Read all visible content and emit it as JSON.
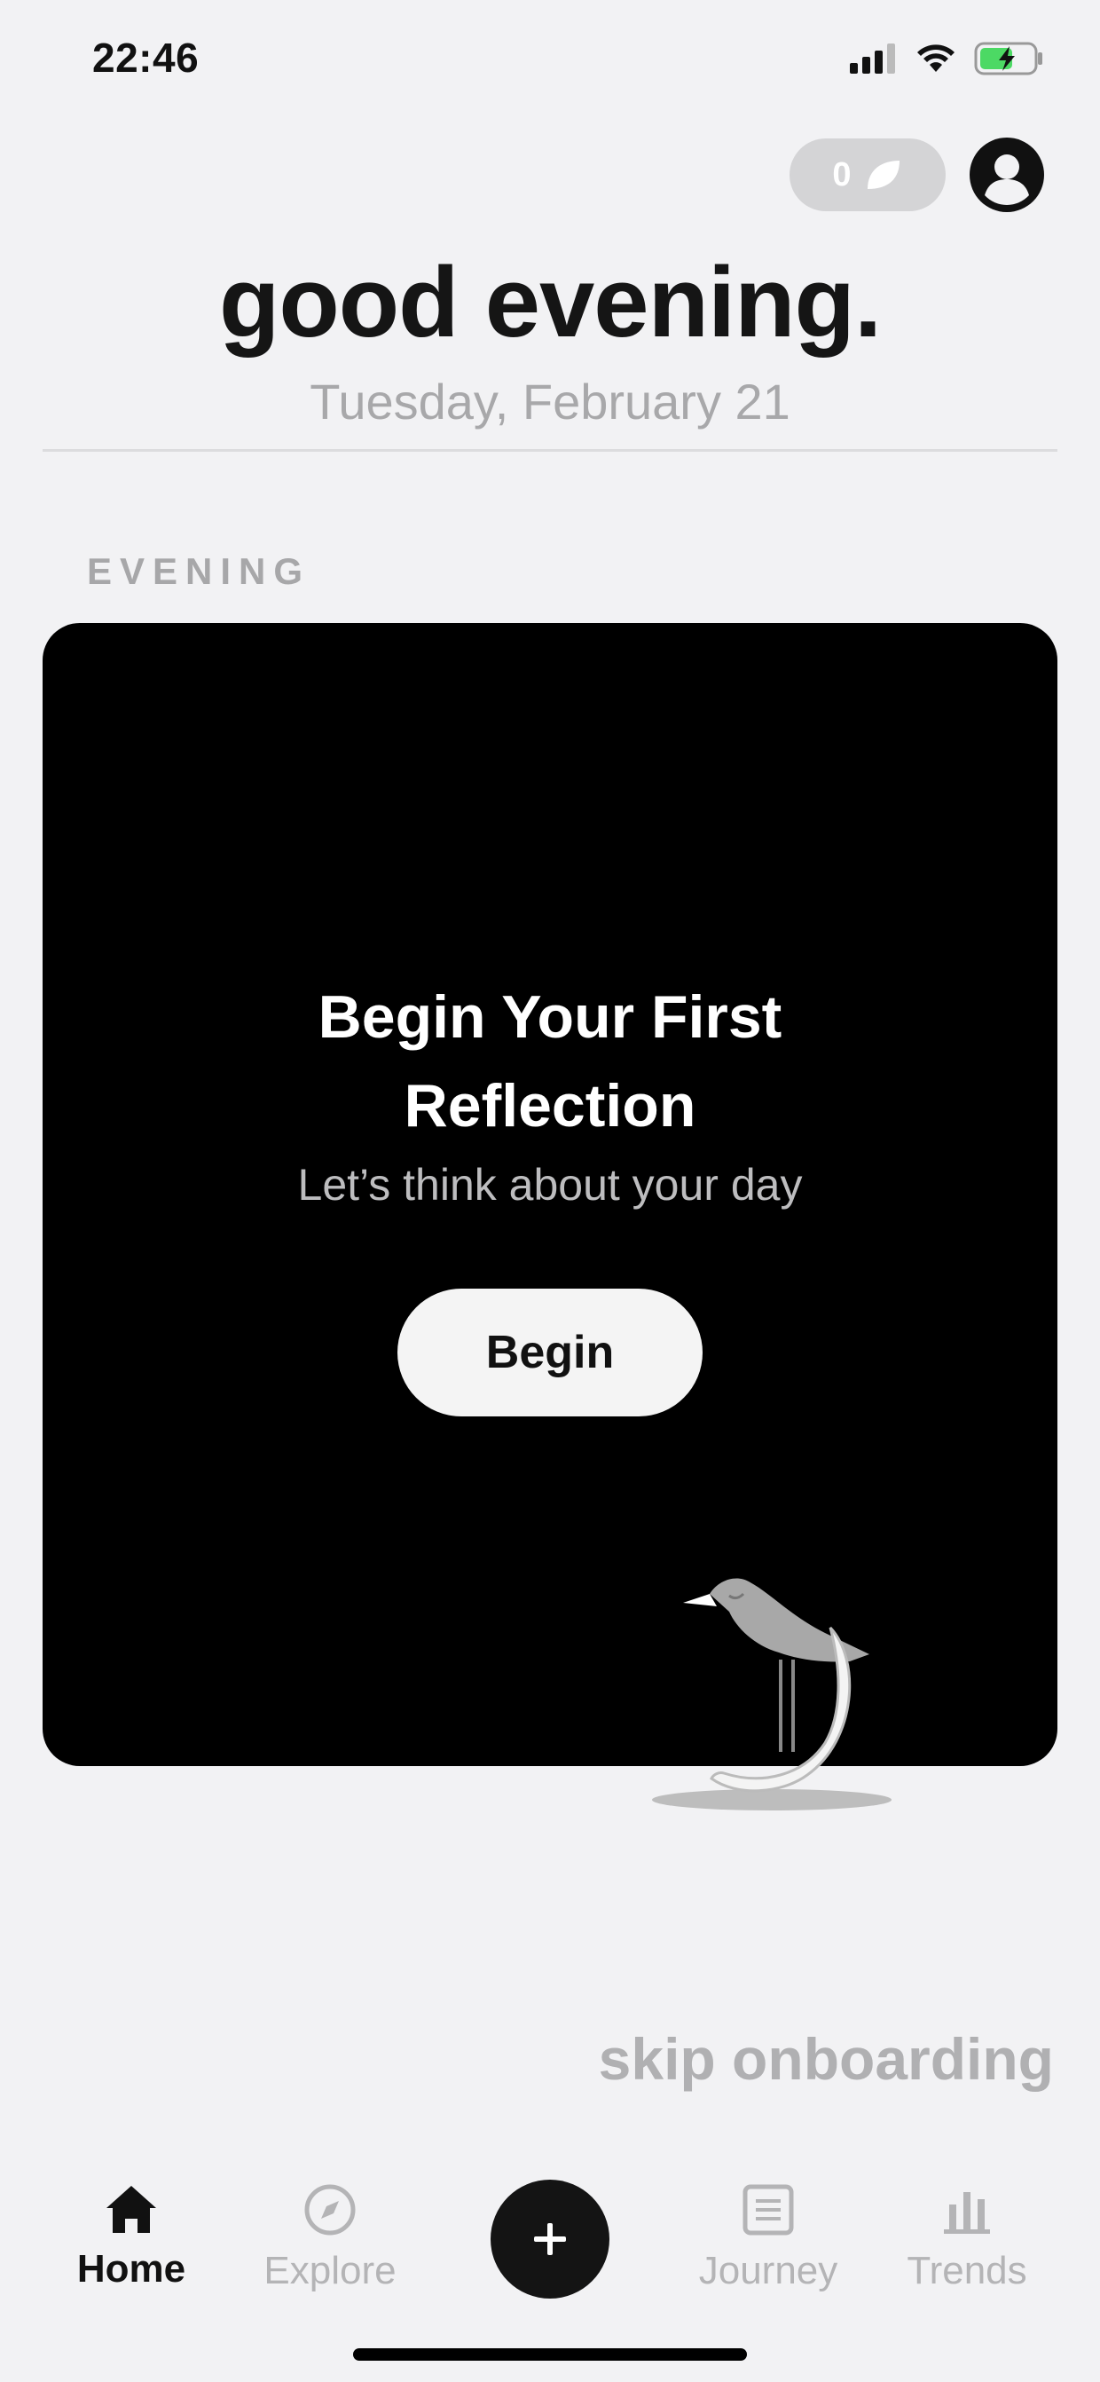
{
  "status_bar": {
    "time": "22:46",
    "icons": [
      "cellular-signal-icon",
      "wifi-icon",
      "battery-charging-icon"
    ],
    "battery_color": "#4cd964"
  },
  "header": {
    "leaf_count": "0",
    "leaf_icon": "leaf-icon",
    "avatar_icon": "profile-icon",
    "greeting": "good evening.",
    "date": "Tuesday, February 21"
  },
  "section": {
    "label": "EVENING"
  },
  "card": {
    "title": "Begin Your First Reflection",
    "subtitle": "Let’s think about your day",
    "button_label": "Begin",
    "illustration": "bird-on-moon-illustration"
  },
  "skip_label": "skip onboarding",
  "tab_bar": {
    "tabs": [
      {
        "label": "Home",
        "icon": "home-icon",
        "active": true
      },
      {
        "label": "Explore",
        "icon": "compass-icon",
        "active": false
      },
      {
        "label": "Journey",
        "icon": "journal-icon",
        "active": false
      },
      {
        "label": "Trends",
        "icon": "bar-chart-icon",
        "active": false
      }
    ],
    "add_icon": "plus-icon"
  }
}
